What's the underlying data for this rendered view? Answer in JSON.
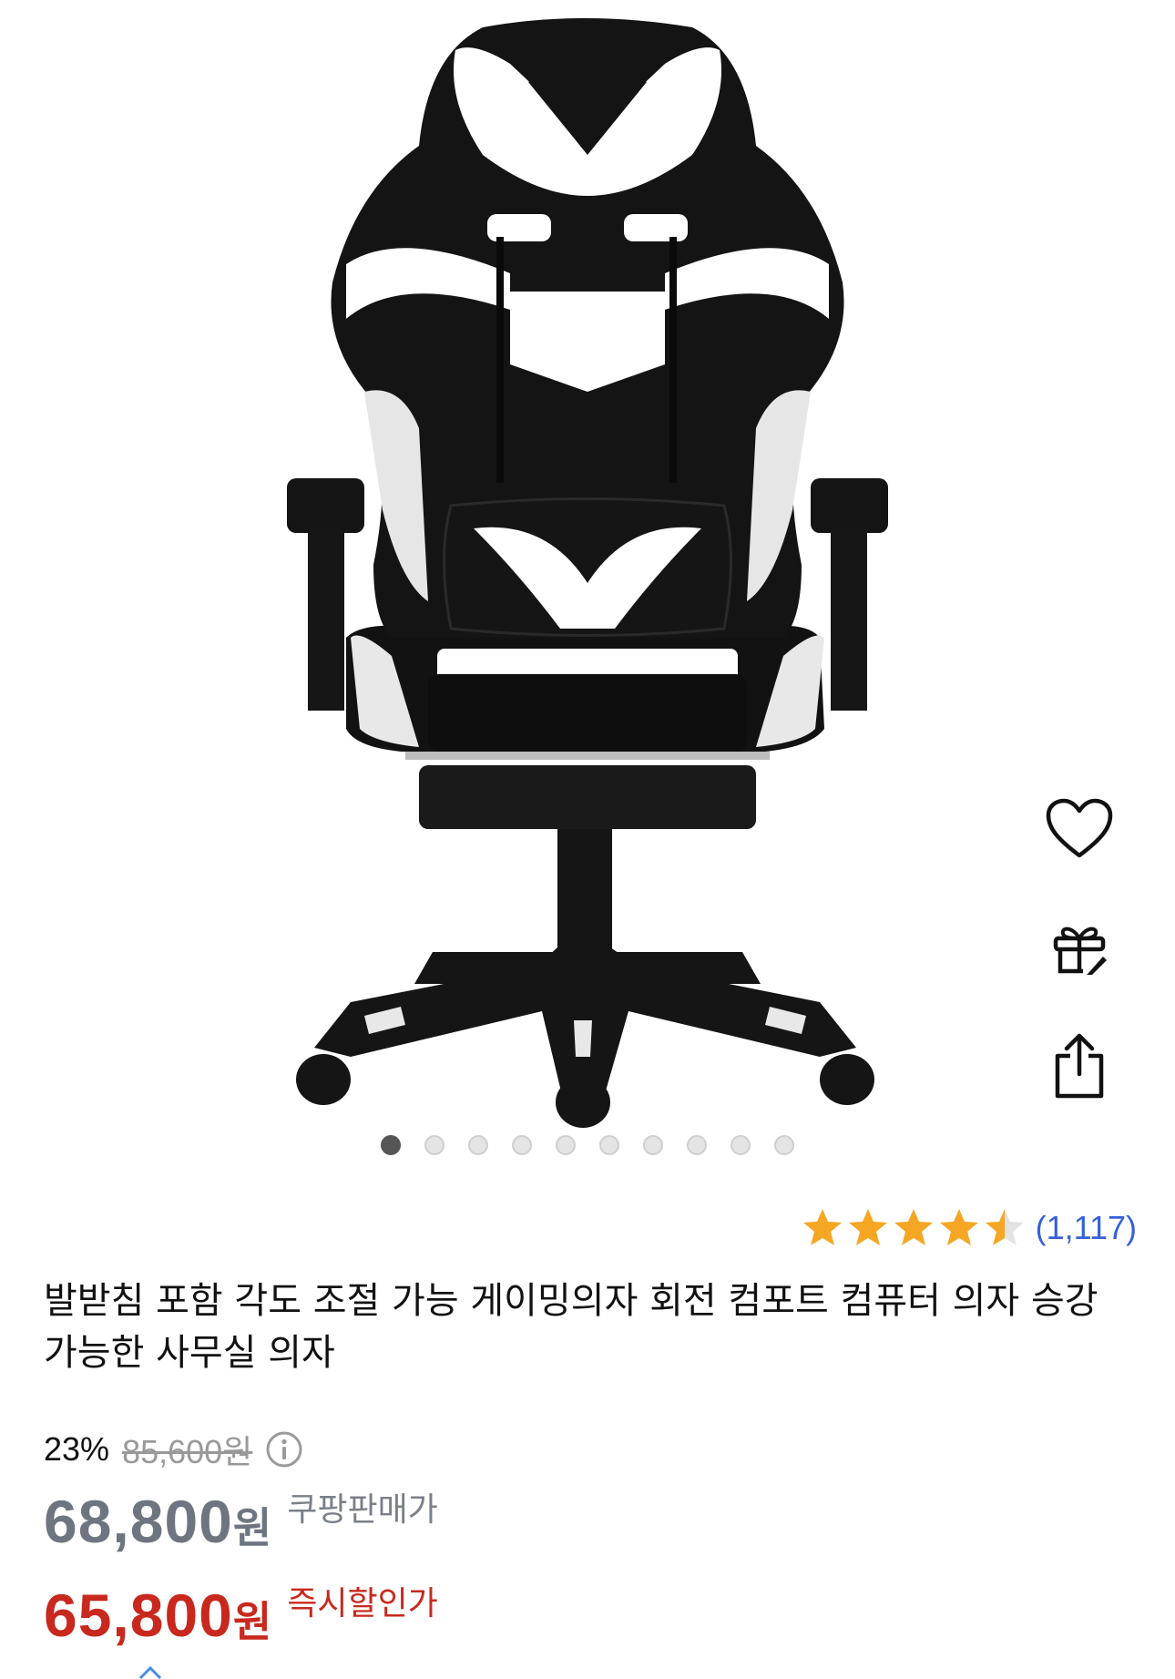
{
  "gallery": {
    "image_alt": "gaming-chair",
    "dots_total": 10,
    "active_index": 0
  },
  "actions": {
    "wishlist_icon": "heart-icon",
    "gift_icon": "gift-icon",
    "share_icon": "share-icon"
  },
  "rating": {
    "stars": 4.5,
    "count_text": "(1,117)",
    "star_color": "#f5a623",
    "count_color": "#3661d9"
  },
  "product": {
    "title": "발받침 포함 각도 조절 가능 게이밍의자 회전 컴포트 컴퓨터 의자 승강 가능한 사무실 의자"
  },
  "price": {
    "discount_rate": "23%",
    "original_price": "85,600원",
    "sale_price_number": "68,800",
    "sale_price_unit": "원",
    "sale_label": "쿠팡판매가",
    "instant_price_number": "65,800",
    "instant_price_unit": "원",
    "instant_label": "즉시할인가",
    "instant_color": "#c8281e"
  }
}
